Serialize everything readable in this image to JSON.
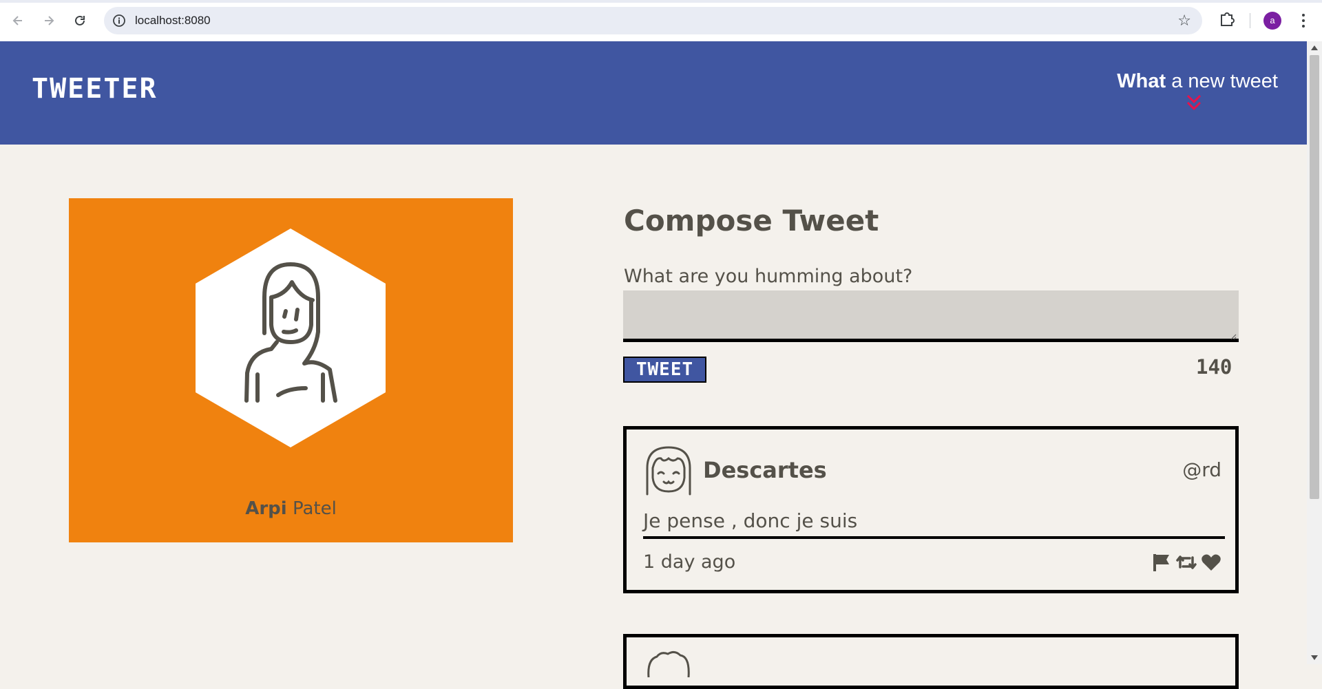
{
  "browser": {
    "url": "localhost:8080",
    "profile_initial": "a"
  },
  "header": {
    "brand": "TWEETER",
    "new_tweet_bold": "What",
    "new_tweet_rest": " a new tweet",
    "accent_color": "#e8114b"
  },
  "profile": {
    "first_name": "Arpi",
    "last_name": "Patel",
    "card_color": "#f0820f"
  },
  "compose": {
    "title": "Compose Tweet",
    "label": "What are you humming about?",
    "textarea_value": "",
    "button_label": "TWEET",
    "counter": "140"
  },
  "tweets": [
    {
      "name": "Descartes",
      "handle": "@rd",
      "content": "Je pense , donc je suis",
      "time": "1 day ago",
      "actions": [
        "flag-icon",
        "retweet-icon",
        "heart-icon"
      ]
    }
  ],
  "colors": {
    "header_bg": "#4056a1",
    "page_bg": "#f4f1ec",
    "text": "#545149"
  }
}
